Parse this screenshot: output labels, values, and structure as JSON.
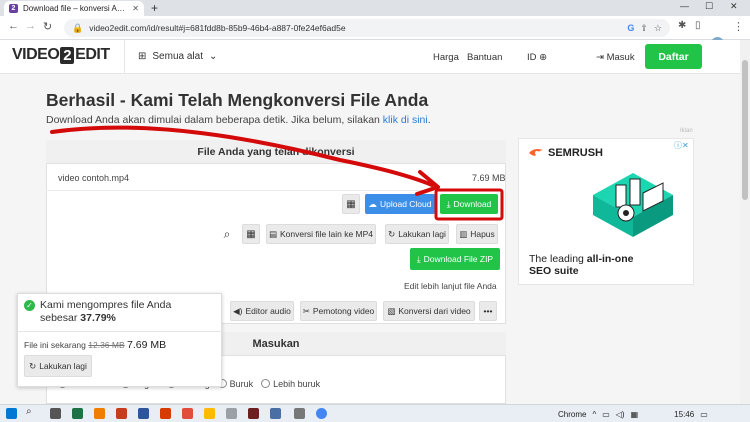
{
  "browser": {
    "tab_title": "Download file – konversi Anda b...",
    "url": "video2edit.com/id/result#j=681fdd8b-85b9-46b4-a887-0fe24ef6ad5e",
    "new_tab": "+",
    "minimize": "—",
    "maximize": "☐",
    "close": "✕"
  },
  "header": {
    "logo_left": "VIDEO",
    "logo_num": "2",
    "logo_right": "EDIT",
    "tools_label": "Semua alat",
    "links": [
      "Harga",
      "Bantuan",
      "ID"
    ],
    "login": "Masuk",
    "signup": "Daftar"
  },
  "main": {
    "title": "Berhasil - Kami Telah Mengkonversi File Anda",
    "subtitle": "Download Anda akan dimulai dalam beberapa detik. Jika belum, silakan ",
    "subtitle_link": "klik di sini",
    "subtitle_end": ".",
    "panel_title": "File Anda yang telah dikonversi",
    "file_name": "video contoh.mp4",
    "file_size": "7.69 MB",
    "upload_cloud": "Upload Cloud",
    "download": "Download",
    "convert_other": "Konversi file lain ke MP4",
    "redo": "Lakukan lagi",
    "delete": "Hapus",
    "download_zip": "Download File ZIP",
    "edit_more": "Edit lebih lanjut file Anda",
    "edit_tools": [
      "Editor audio",
      "Pemotong video",
      "Konversi dari video"
    ],
    "more": "•••",
    "feedback_title": "Masukan",
    "ratings": [
      "Luar Biasa",
      "Bagus",
      "Sedang",
      "Buruk",
      "Lebih buruk"
    ]
  },
  "toast": {
    "message": "Kami mengompres file Anda sebesar ",
    "percent": "37.79%",
    "size_label": "File ini sekarang ",
    "old_size": "12.36 MB",
    "new_size": "7.69 MB",
    "redo": "Lakukan lagi"
  },
  "ad": {
    "label": "Iklan",
    "brand": "SEMRUSH",
    "line1": "The leading ",
    "line1_bold": "all-in-one",
    "line2": "SEO suite"
  },
  "taskbar": {
    "app": "Chrome",
    "time": "15:46"
  },
  "colors": {
    "green": "#22c447",
    "blue": "#3b8fe8",
    "annotation_red": "#d40a0a"
  }
}
